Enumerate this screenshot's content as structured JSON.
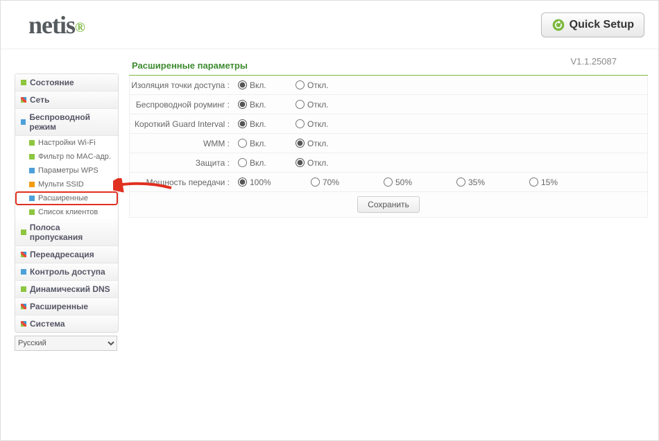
{
  "header": {
    "logo": "netis",
    "quick_setup": "Quick Setup"
  },
  "version": "V1.1.25087",
  "sidebar": {
    "items": [
      {
        "label": "Состояние",
        "icon": "green"
      },
      {
        "label": "Сеть",
        "icon": "multi"
      },
      {
        "label": "Беспроводной режим",
        "icon": "blue",
        "expanded": true,
        "sub": [
          {
            "label": "Настройки Wi-Fi",
            "icon": "green"
          },
          {
            "label": "Фильтр по MAC-адр.",
            "icon": "green"
          },
          {
            "label": "Параметры WPS",
            "icon": "blue"
          },
          {
            "label": "Мульти SSID",
            "icon": "orange"
          },
          {
            "label": "Расширенные",
            "icon": "blue",
            "active": true
          },
          {
            "label": "Список клиентов",
            "icon": "green"
          }
        ]
      },
      {
        "label": "Полоса пропускания",
        "icon": "green"
      },
      {
        "label": "Переадресация",
        "icon": "multi"
      },
      {
        "label": "Контроль доступа",
        "icon": "blue"
      },
      {
        "label": "Динамический DNS",
        "icon": "green"
      },
      {
        "label": "Расширенные",
        "icon": "multi"
      },
      {
        "label": "Система",
        "icon": "multi"
      }
    ],
    "language": "Русский"
  },
  "panel": {
    "title": "Расширенные параметры",
    "on": "Вкл.",
    "off": "Откл.",
    "rows": {
      "ap_isolation": "Изоляция точки доступа :",
      "roaming": "Беспроводной роуминг :",
      "guard": "Короткий Guard Interval :",
      "wmm": "WMM :",
      "protect": "Защита :",
      "txpower": "Мощность передачи :"
    },
    "power_opts": [
      "100%",
      "70%",
      "50%",
      "35%",
      "15%"
    ],
    "selected": {
      "ap_isolation": "on",
      "roaming": "on",
      "guard": "on",
      "wmm": "off",
      "protect": "off",
      "txpower": "100%"
    },
    "save": "Сохранить"
  }
}
